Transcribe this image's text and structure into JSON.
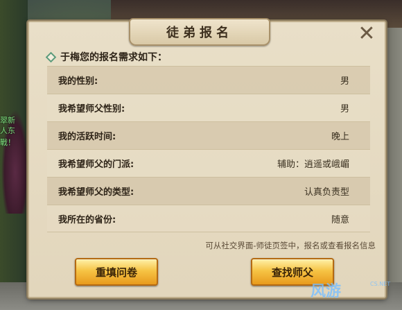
{
  "background": {
    "side_texts": [
      "翠新",
      "人东",
      "戰！"
    ]
  },
  "dialog": {
    "title": "徒弟报名",
    "close_glyph": "✕",
    "intro": "于梅您的报名需求如下：",
    "rows": [
      {
        "label": "我的性别:",
        "value": "男"
      },
      {
        "label": "我希望师父性别:",
        "value": "男"
      },
      {
        "label": "我的活跃时间:",
        "value": "晚上"
      },
      {
        "label": "我希望师父的门派:",
        "value": "辅助：逍遥或峨嵋"
      },
      {
        "label": "我希望师父的类型:",
        "value": "认真负责型"
      },
      {
        "label": "我所在的省份:",
        "value": "随意"
      }
    ],
    "hint": "可从社交界面-师徒页签中，报名或查看报名信息",
    "buttons": {
      "refill": "重填问卷",
      "find": "查找师父"
    }
  },
  "watermark": {
    "text": "风游",
    "small": "CS.NET"
  }
}
